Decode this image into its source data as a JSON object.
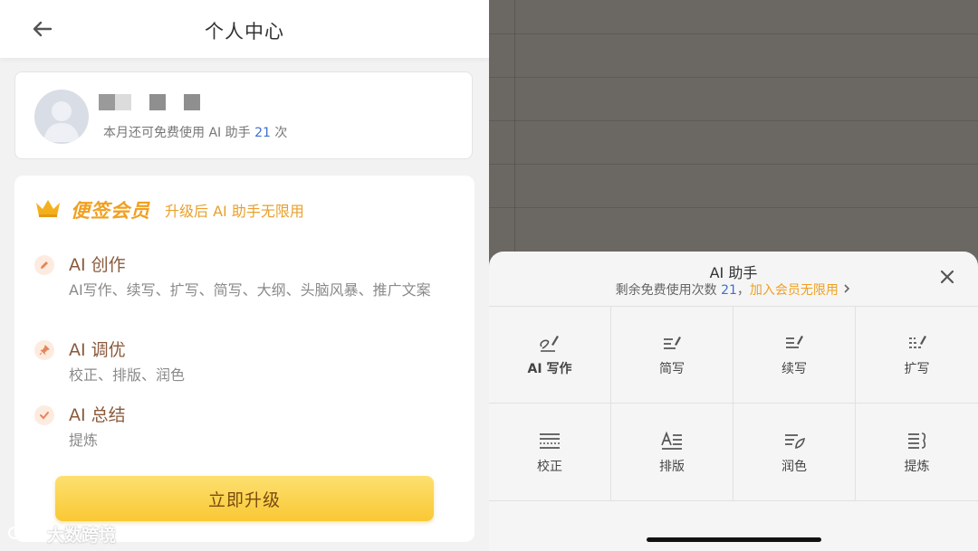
{
  "left": {
    "header": {
      "title": "个人中心",
      "back_icon": "arrow-left-icon"
    },
    "user": {
      "usage_prefix": "本月还可免费使用 AI 助手 ",
      "usage_count": "21",
      "usage_suffix": " 次"
    },
    "membership": {
      "title": "便签会员",
      "subtitle": "升级后 AI 助手无限用",
      "features": [
        {
          "title": "AI 创作",
          "desc": "AI写作、续写、扩写、简写、大纲、头脑风暴、推广文案",
          "icon": "pencil-icon"
        },
        {
          "title": "AI 调优",
          "desc": "校正、排版、润色",
          "icon": "pin-icon"
        },
        {
          "title": "AI 总结",
          "desc": "提炼",
          "icon": "check-icon"
        }
      ],
      "upgrade_label": "立即升级"
    },
    "watermark": "大数跨境"
  },
  "right": {
    "sheet": {
      "title": "AI 助手",
      "remaining_prefix": "剩余免费使用次数 ",
      "remaining_count": "21",
      "separator": "，",
      "join_label": "加入会员无限用",
      "close_icon": "close-icon"
    },
    "tools": [
      {
        "label": "AI 写作",
        "icon": "ai-write-icon"
      },
      {
        "label": "简写",
        "icon": "shorten-icon"
      },
      {
        "label": "续写",
        "icon": "continue-icon"
      },
      {
        "label": "扩写",
        "icon": "expand-icon"
      },
      {
        "label": "校正",
        "icon": "proofread-icon"
      },
      {
        "label": "排版",
        "icon": "layout-icon"
      },
      {
        "label": "润色",
        "icon": "polish-icon"
      },
      {
        "label": "提炼",
        "icon": "refine-icon"
      }
    ]
  },
  "colors": {
    "accent_orange": "#f0a020",
    "link_blue": "#3f6fcf",
    "button_yellow": "#f9c834",
    "note_background": "#6b6863"
  }
}
